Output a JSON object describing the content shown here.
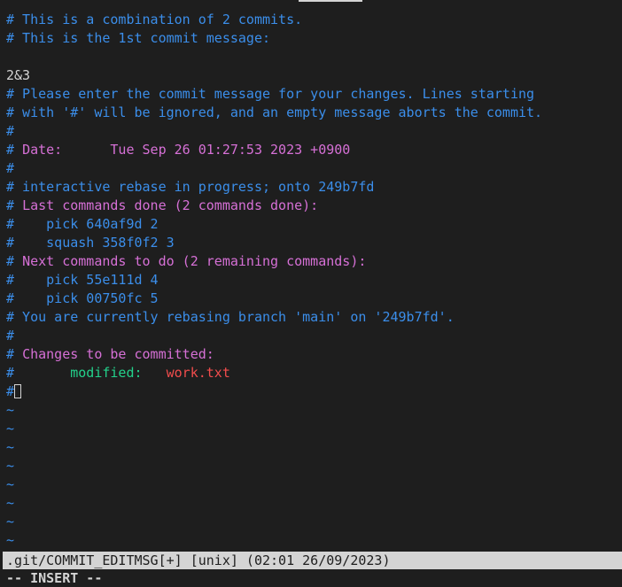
{
  "lines": [
    "# This is a combination of 2 commits.",
    "# This is the 1st commit message:",
    "",
    "2&3",
    "# Please enter the commit message for your changes. Lines starting",
    "# with '#' will be ignored, and an empty message aborts the commit.",
    "#",
    "# ",
    "Date:",
    "Tue Sep 26 01:27:53 2023 +0900",
    "#",
    "# interactive rebase in progress; onto 249b7fd",
    "# ",
    "Last commands done (2 commands done):",
    "#    ",
    "pick 640af9d 2",
    "#    ",
    "squash 358f0f2 3",
    "# ",
    "Next commands to do (2 remaining commands):",
    "#    ",
    "pick 55e111d 4",
    "#    ",
    "pick 00750fc 5",
    "# You are currently rebasing branch 'main' on '249b7fd'.",
    "#",
    "# ",
    "Changes to be committed:",
    "#       ",
    "modified:",
    "work.txt",
    "#"
  ],
  "tilde": "~",
  "status_bar": ".git/COMMIT_EDITMSG[+] [unix] (02:01 26/09/2023)",
  "mode": "-- INSERT --",
  "colors": {
    "comment": "#3b8eea",
    "keyword": "#d670d6",
    "modified_label": "#23d18b",
    "filename": "#f14c4c"
  }
}
